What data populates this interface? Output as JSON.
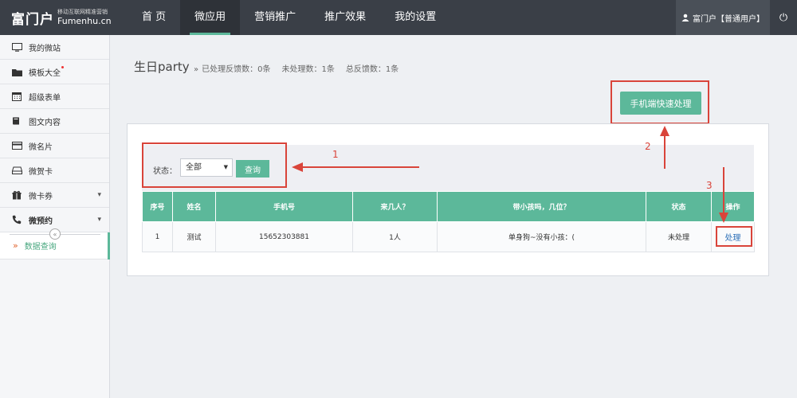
{
  "header": {
    "logo_main": "富门户",
    "logo_tagline": "移动互联网精准营销",
    "logo_domain": "Fumenhu.cn",
    "nav": [
      {
        "label": "首 页",
        "active": false
      },
      {
        "label": "微应用",
        "active": true
      },
      {
        "label": "营销推广",
        "active": false
      },
      {
        "label": "推广效果",
        "active": false
      },
      {
        "label": "我的设置",
        "active": false
      }
    ],
    "user_label": "富门户【普通用户】",
    "power_icon": "power-icon"
  },
  "sidebar": {
    "items": [
      {
        "label": "我的微站",
        "icon": "monitor-icon"
      },
      {
        "label": "模板大全",
        "icon": "folder-icon"
      },
      {
        "label": "超级表单",
        "icon": "calendar-icon"
      },
      {
        "label": "图文内容",
        "icon": "book-icon"
      },
      {
        "label": "微名片",
        "icon": "card-icon"
      },
      {
        "label": "微贺卡",
        "icon": "tray-icon"
      },
      {
        "label": "微卡券",
        "icon": "gift-icon"
      },
      {
        "label": "微预约",
        "icon": "phone-icon"
      }
    ],
    "sub_item": "数据查询",
    "collapse_glyph": "«"
  },
  "page": {
    "title": "生日party",
    "stats": {
      "arrow": "»",
      "processed": "已处理反馈数：0条",
      "unprocessed": "未处理数：1条",
      "total": "总反馈数：1条"
    },
    "mobile_button": "手机端快速处理"
  },
  "filter": {
    "label": "状态：",
    "select_value": "全部",
    "query_button": "查询"
  },
  "table": {
    "columns": [
      "序号",
      "姓名",
      "手机号",
      "来几人？",
      "带小孩吗，几位？",
      "状态",
      "操作"
    ],
    "rows": [
      {
        "no": "1",
        "name": "测试",
        "phone": "15652303881",
        "count": "1人",
        "kids": "单身狗~没有小孩：(",
        "status": "未处理",
        "action": "处理"
      }
    ]
  },
  "annotations": [
    "1",
    "2",
    "3"
  ],
  "colors": {
    "accent": "#5cb89a",
    "topbar": "#3a3f47",
    "annotation_red": "#d9443a",
    "link": "#2c6fb7"
  }
}
